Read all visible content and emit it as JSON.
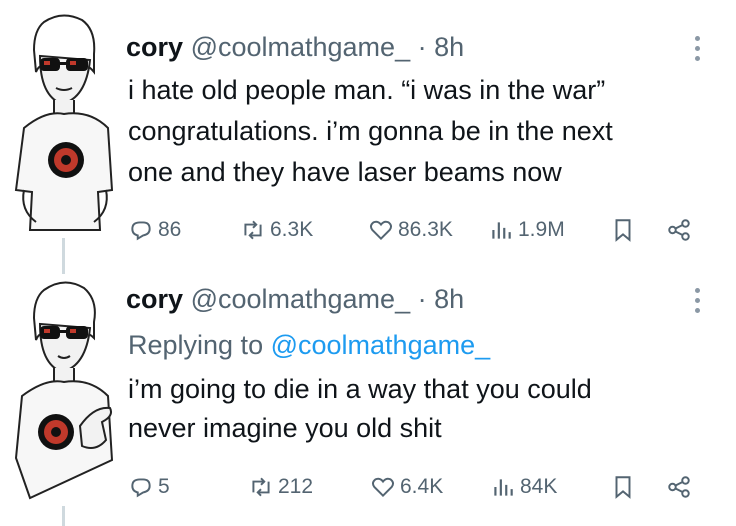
{
  "tweets": [
    {
      "name": "cory",
      "handle": "@coolmathgame_",
      "separator": "·",
      "time": "8h",
      "replying_label": "",
      "replying_to": "",
      "text_lines": [
        "i hate old people man. “i was in the war”",
        "congratulations. i’m gonna be in the next",
        "one and they have laser beams now"
      ],
      "replies": "86",
      "retweets": "6.3K",
      "likes": "86.3K",
      "views": "1.9M"
    },
    {
      "name": "cory",
      "handle": "@coolmathgame_",
      "separator": "·",
      "time": "8h",
      "replying_label": "Replying to",
      "replying_to": "@coolmathgame_",
      "text_lines": [
        "i’m going to die in a way that you could",
        "never imagine you old shit"
      ],
      "replies": "5",
      "retweets": "212",
      "likes": "6.4K",
      "views": "84K"
    }
  ],
  "icons": {
    "reply": "reply-icon",
    "retweet": "retweet-icon",
    "like": "heart-icon",
    "views": "views-icon",
    "bookmark": "bookmark-icon",
    "share": "share-icon",
    "more": "more-dots-icon"
  },
  "colors": {
    "text": "#0f1419",
    "secondary": "#536471",
    "link": "#1d9bf0",
    "thread_line": "#cfd9de"
  }
}
